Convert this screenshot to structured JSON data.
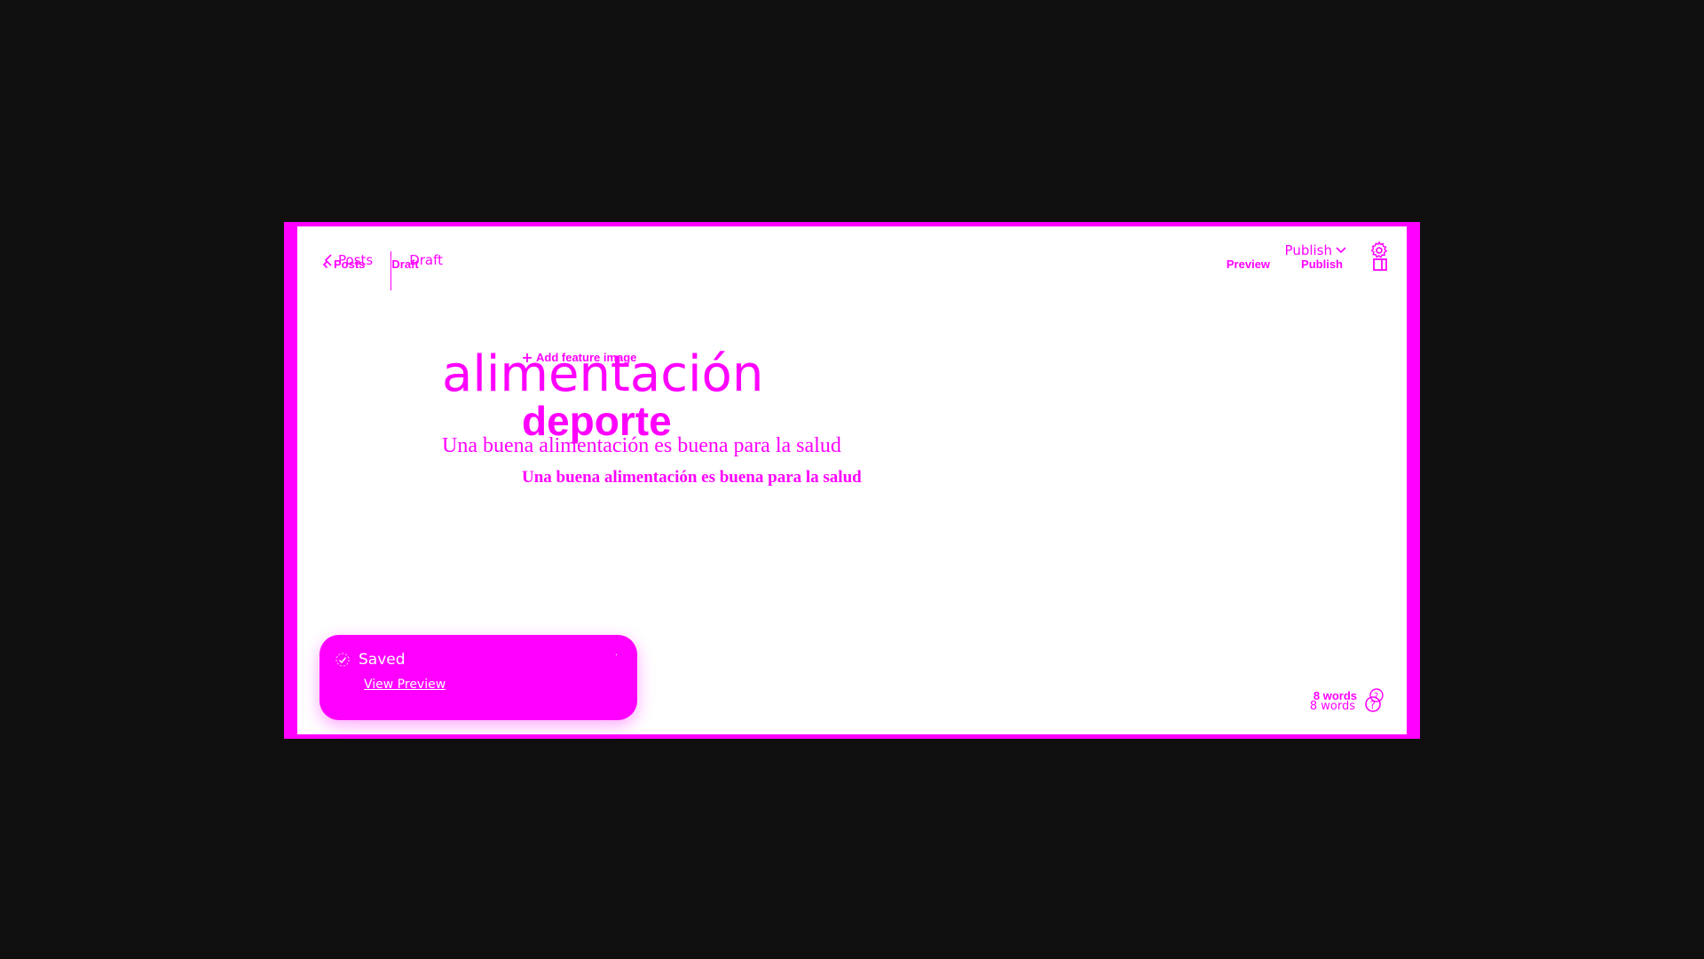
{
  "header": {
    "back_label_faint": "Posts",
    "status_faint": "Draft",
    "back_label": "Posts",
    "status": "Draft",
    "publish_menu_faint": "Publish",
    "preview_label": "Preview",
    "publish_label": "Publish"
  },
  "editor": {
    "add_feature_image": "Add feature image",
    "title_faint": "alimentación",
    "title": "deporte",
    "body_faint": "Una buena alimentación es buena para la salud",
    "body": "Una buena alimentación es buena para la salud"
  },
  "toast": {
    "message": "Saved",
    "link": "View Preview",
    "close": "·"
  },
  "footer": {
    "word_count_bold": "8 words",
    "word_count": "8 words"
  },
  "colors": {
    "accent": "#ff00ff",
    "background": "#0f0f0f",
    "canvas": "#ffffff"
  },
  "icons": [
    "chevron-left-icon",
    "chevron-down-icon",
    "gear-icon",
    "sidebar-toggle-icon",
    "plus-icon",
    "check-icon",
    "help-icon"
  ]
}
